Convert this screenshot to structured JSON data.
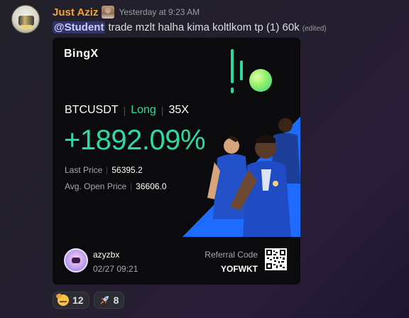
{
  "message": {
    "author": "Just Aziz",
    "timestamp": "Yesterday at 9:23 AM",
    "mention": "@Student",
    "text": "trade mzlt halha kima koltlkom tp (1) 60k",
    "edited_label": "(edited)"
  },
  "card": {
    "brand": "BingX",
    "pair": "BTCUSDT",
    "direction": "Long",
    "leverage": "35X",
    "pnl": "+1892.09%",
    "last_price_label": "Last Price",
    "last_price": "56395.2",
    "avg_open_label": "Avg. Open Price",
    "avg_open": "36606.0",
    "user": "azyzbx",
    "date": "02/27 09:21",
    "referral_label": "Referral Code",
    "referral_code": "YOFWKT"
  },
  "reactions": [
    {
      "icon": "saluting-face-icon",
      "count": "12"
    },
    {
      "icon": "rocket-icon",
      "count": "8"
    }
  ],
  "colors": {
    "username": "#f0a232",
    "accent_green": "#2ed9a3",
    "card_bg": "#0b0b0d",
    "mention_bg": "#3e4479"
  }
}
